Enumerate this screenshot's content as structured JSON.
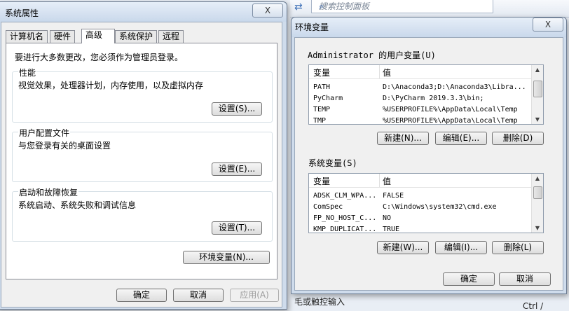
{
  "background": {
    "search_placeholder": "搜索控制面板",
    "fragment_bottom": "毛或触控输入",
    "fragment_corner": "Ctrl /"
  },
  "system_properties": {
    "title": "系统属性",
    "close_label": "X",
    "tabs": [
      "计算机名",
      "硬件",
      "高级",
      "系统保护",
      "远程"
    ],
    "admin_notice": "要进行大多数更改，您必须作为管理员登录。",
    "performance": {
      "label": "性能",
      "desc": "视觉效果，处理器计划，内存使用，以及虚拟内存",
      "button": "设置(S)..."
    },
    "user_profiles": {
      "label": "用户配置文件",
      "desc": "与您登录有关的桌面设置",
      "button": "设置(E)..."
    },
    "startup_recovery": {
      "label": "启动和故障恢复",
      "desc": "系统启动、系统失败和调试信息",
      "button": "设置(T)..."
    },
    "env_button": "环境变量(N)...",
    "ok": "确定",
    "cancel": "取消",
    "apply": "应用(A)"
  },
  "environment_variables": {
    "title": "环境变量",
    "close_label": "X",
    "user_section_label": "Administrator 的用户变量(U)",
    "user_columns": [
      "变量",
      "值"
    ],
    "user_vars": [
      [
        "PATH",
        "D:\\Anaconda3;D:\\Anaconda3\\Libra..."
      ],
      [
        "PyCharm",
        "D:\\PyCharm 2019.3.3\\bin;"
      ],
      [
        "TEMP",
        "%USERPROFILE%\\AppData\\Local\\Temp"
      ],
      [
        "TMP",
        "%USERPROFILE%\\AppData\\Local\\Temp"
      ]
    ],
    "user_buttons": {
      "new": "新建(N)...",
      "edit": "编辑(E)...",
      "delete": "删除(D)"
    },
    "system_section_label": "系统变量(S)",
    "system_columns": [
      "变量",
      "值"
    ],
    "system_vars": [
      [
        "ADSK_CLM_WPA...",
        "FALSE"
      ],
      [
        "ComSpec",
        "C:\\Windows\\system32\\cmd.exe"
      ],
      [
        "FP_NO_HOST_C...",
        "NO"
      ],
      [
        "KMP_DUPLICAT...",
        "TRUE"
      ]
    ],
    "system_buttons": {
      "new": "新建(W)...",
      "edit": "编辑(I)...",
      "delete": "删除(L)"
    },
    "ok": "确定",
    "cancel": "取消"
  }
}
